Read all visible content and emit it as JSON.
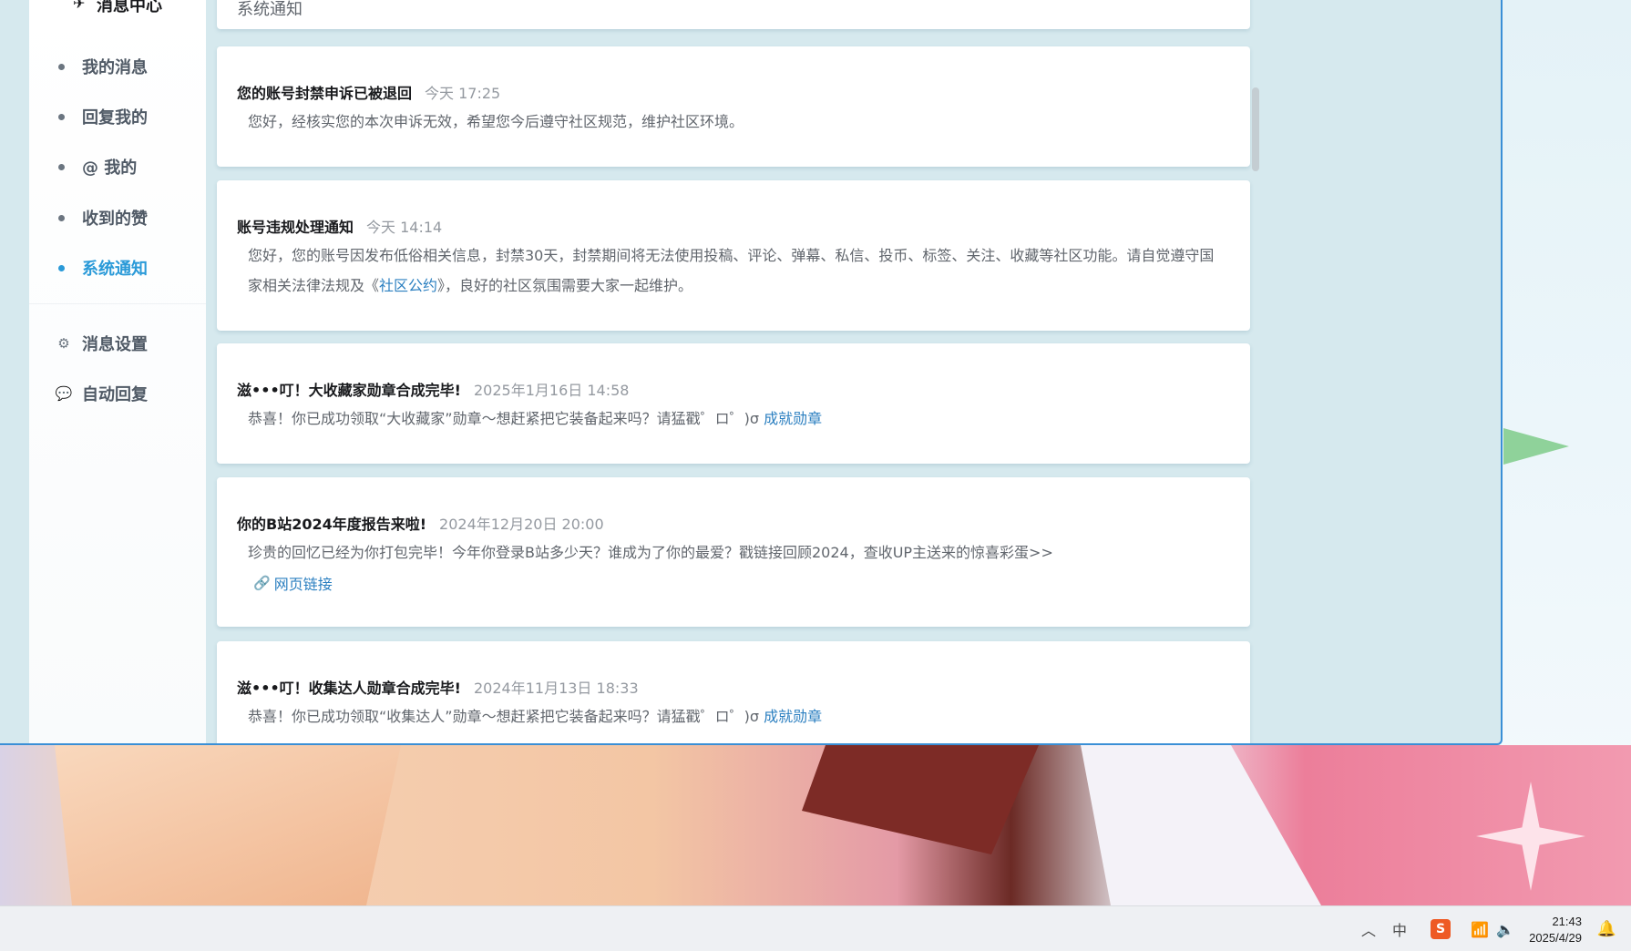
{
  "sidebar": {
    "title": "消息中心",
    "items": [
      {
        "label": "我的消息",
        "active": false
      },
      {
        "label": "回复我的",
        "active": false
      },
      {
        "label": "@ 我的",
        "active": false
      },
      {
        "label": "收到的赞",
        "active": false
      },
      {
        "label": "系统通知",
        "active": true
      }
    ],
    "settings": [
      {
        "label": "消息设置",
        "icon": "gear-icon"
      },
      {
        "label": "自动回复",
        "icon": "chat-bubble-icon"
      }
    ]
  },
  "feed": {
    "header_label": "系统通知",
    "notices": [
      {
        "title": "您的账号封禁申诉已被退回",
        "time": "今天 17:25",
        "body": "您好，经核实您的本次申诉无效，希望您今后遵守社区规范，维护社区环境。"
      },
      {
        "title": "账号违规处理通知",
        "time": "今天 14:14",
        "body_pre": "您好，您的账号因发布低俗相关信息，封禁30天，封禁期间将无法使用投稿、评论、弹幕、私信、投币、标签、关注、收藏等社区功能。请自觉遵守国家相关法律法规及《",
        "body_link": "社区公约",
        "body_post": "》，良好的社区氛围需要大家一起维护。"
      },
      {
        "title": "滋•••叮！大收藏家勋章合成完毕!",
        "time": "2025年1月16日 14:58",
        "body": "恭喜！你已成功领取“大收藏家”勋章～想赶紧把它装备起来吗？请猛戳゜ロ゜)σ ",
        "body_link": "成就勋章"
      },
      {
        "title": "你的B站2024年度报告来啦!",
        "time": "2024年12月20日 20:00",
        "body": "珍贵的回忆已经为你打包完毕！今年你登录B站多少天？谁成为了你的最爱？戳链接回顾2024，查收UP主送来的惊喜彩蛋>>",
        "web_link": "网页链接"
      },
      {
        "title": "滋•••叮！收集达人勋章合成完毕!",
        "time": "2024年11月13日 18:33",
        "body": "恭喜！你已成功领取“收集达人”勋章～想赶紧把它装备起来吗？请猛戳゜ロ゜)σ ",
        "body_link": "成就勋章"
      }
    ]
  },
  "taskbar": {
    "ime_label": "中",
    "sogou_label": "S",
    "time": "21:43",
    "date": "2025/4/29"
  },
  "colors": {
    "accent": "#2a9ad8",
    "link": "#2b7fc0",
    "panel_bg": "#d6e9ee"
  }
}
